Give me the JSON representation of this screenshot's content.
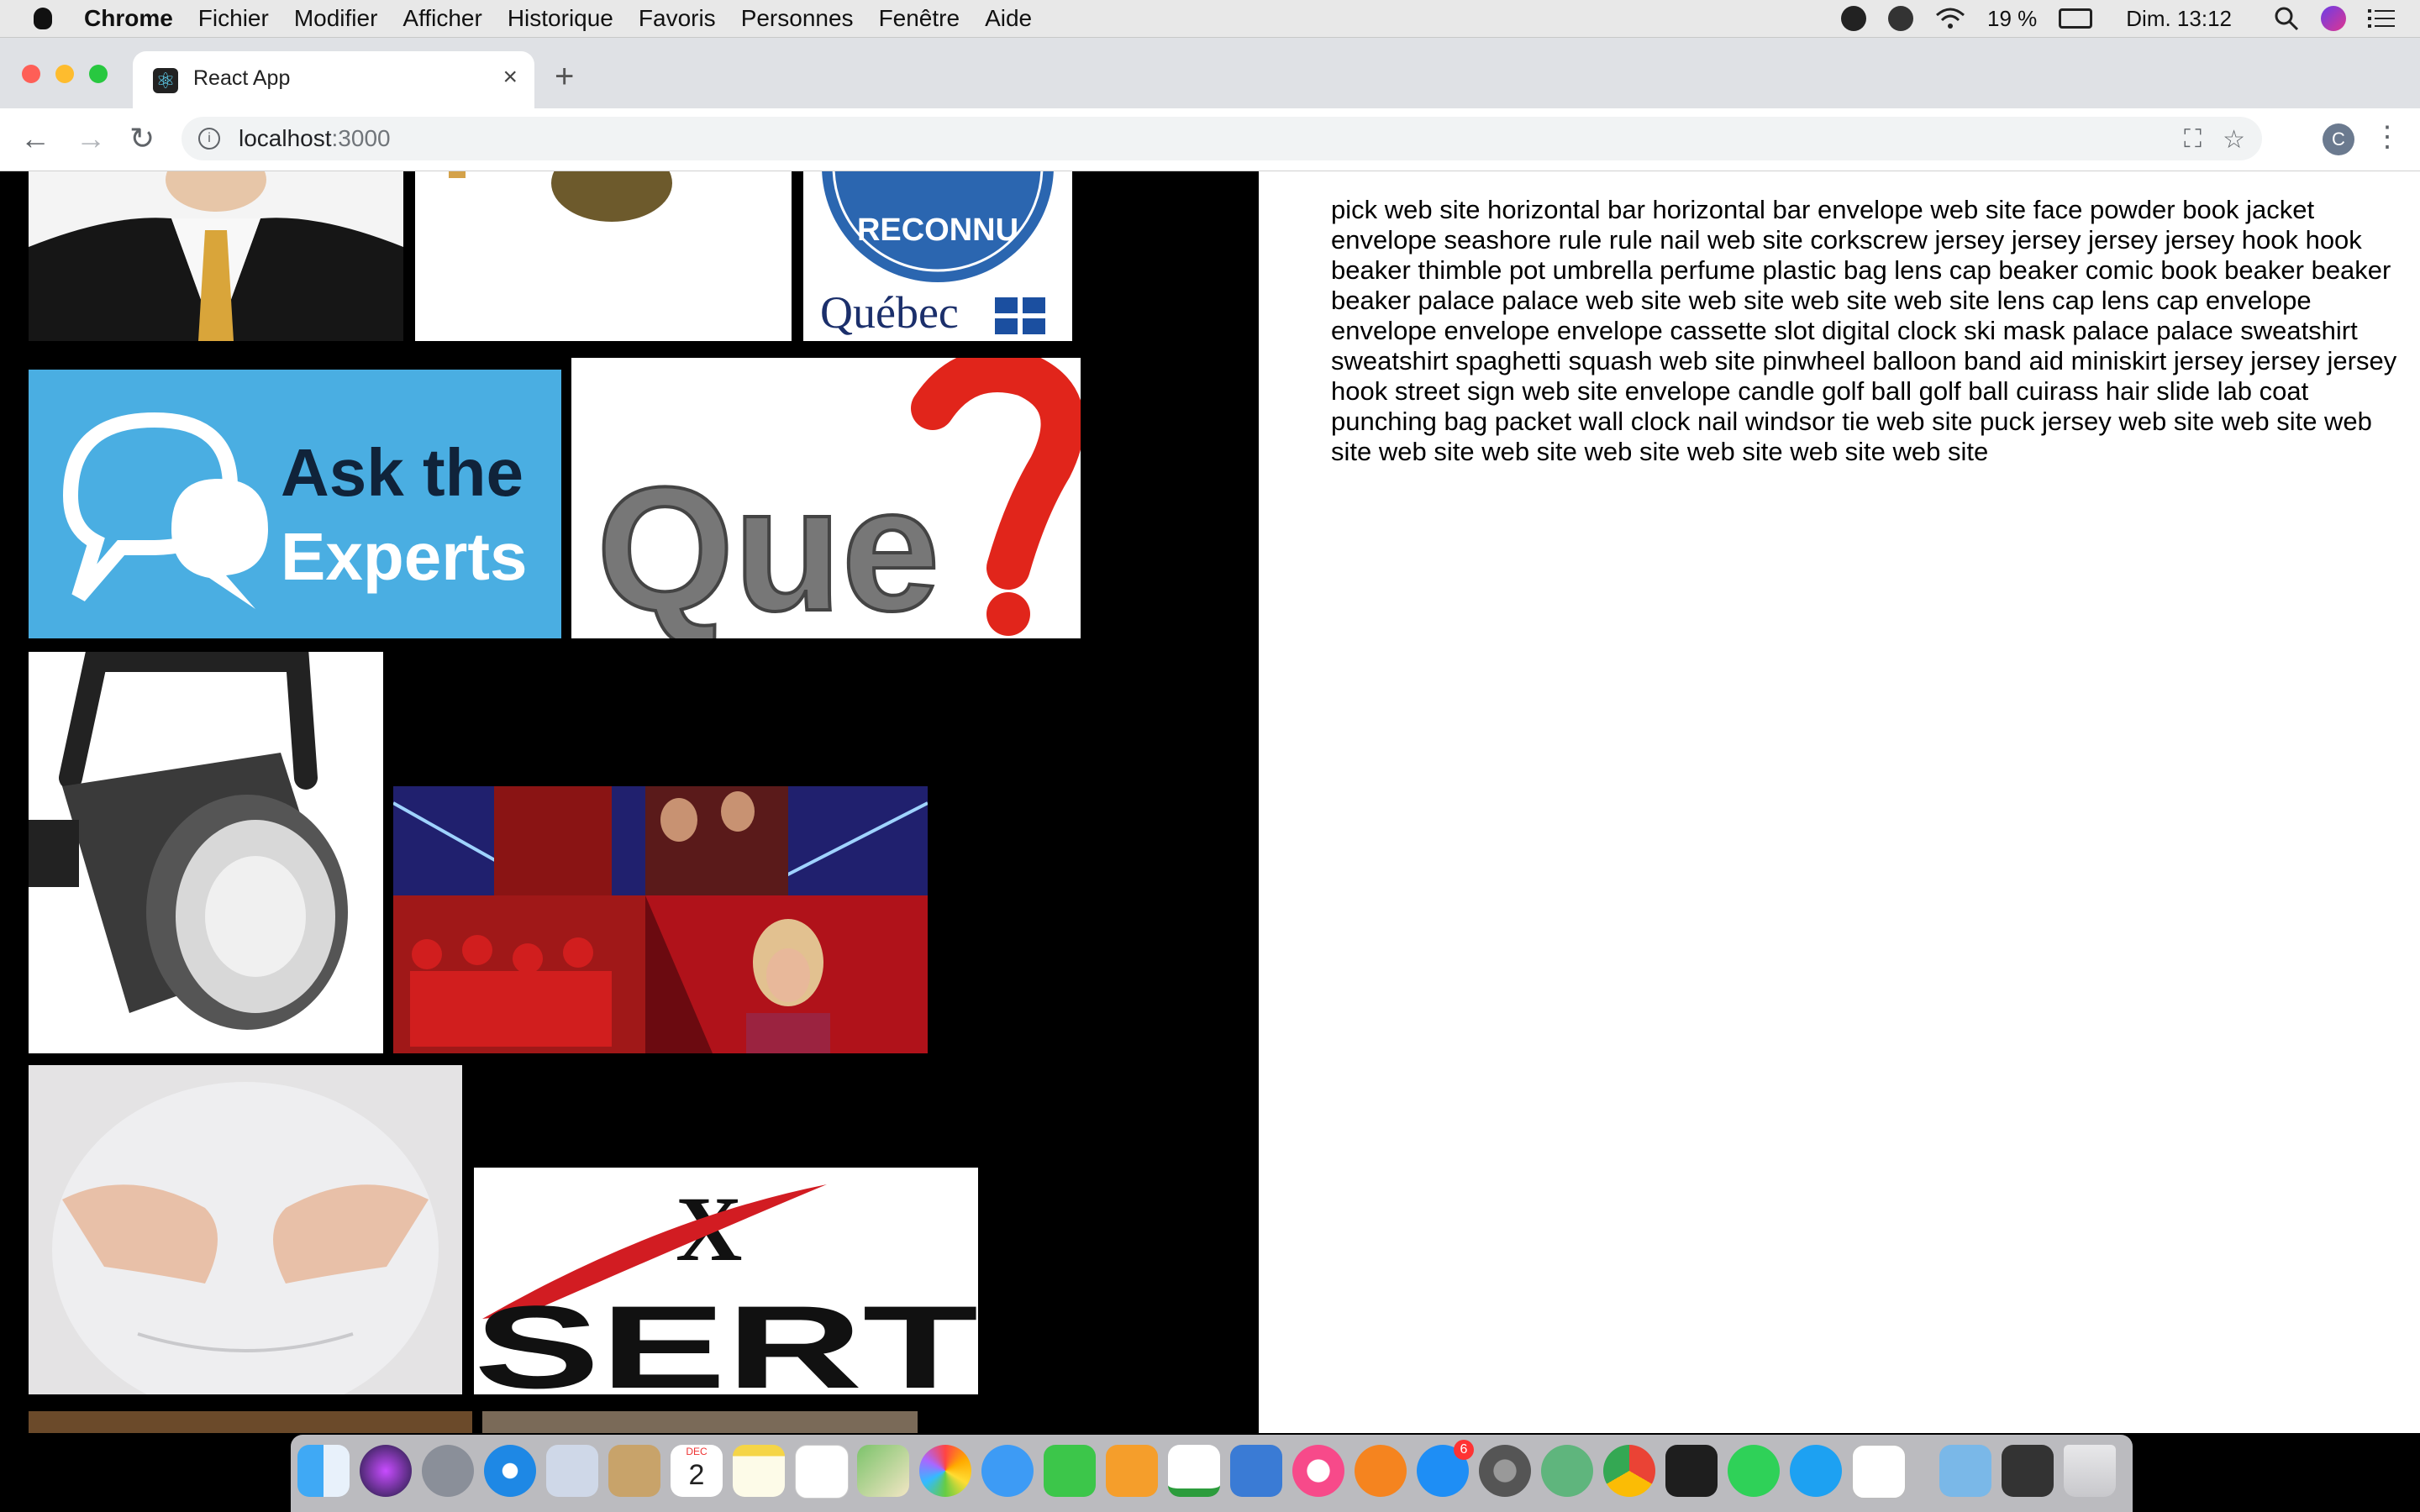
{
  "menubar": {
    "app_name": "Chrome",
    "menus": [
      "Fichier",
      "Modifier",
      "Afficher",
      "Historique",
      "Favoris",
      "Personnes",
      "Fenêtre",
      "Aide"
    ],
    "battery": "19 %",
    "clock": "Dim. 13:12"
  },
  "browser": {
    "tab_title": "React App",
    "url_host": "localhost",
    "url_port": ":3000",
    "profile_initial": "C"
  },
  "images": {
    "ask_experts_line1": "Ask the",
    "ask_experts_line2": "Experts",
    "que_text": "Que",
    "quebec_text": "Québec",
    "reconnu_text": "RECONNU",
    "xsert_x": "X",
    "xsert_text": "SERT"
  },
  "words_text": "pick web site horizontal bar horizontal bar envelope web site face powder book jacket envelope seashore rule rule nail web site corkscrew jersey jersey jersey jersey hook hook beaker thimble pot umbrella perfume plastic bag lens cap beaker comic book beaker beaker beaker palace palace web site web site web site web site lens cap lens cap envelope envelope envelope envelope cassette slot digital clock ski mask palace palace sweatshirt sweatshirt spaghetti squash web site pinwheel balloon band aid miniskirt jersey jersey jersey hook street sign web site envelope candle golf ball golf ball cuirass hair slide lab coat punching bag packet wall clock nail windsor tie web site puck jersey web site web site web site web site web site web site web site web site web site",
  "dock": {
    "calendar_month": "DEC",
    "calendar_day": "2",
    "appstore_badge": "6"
  }
}
